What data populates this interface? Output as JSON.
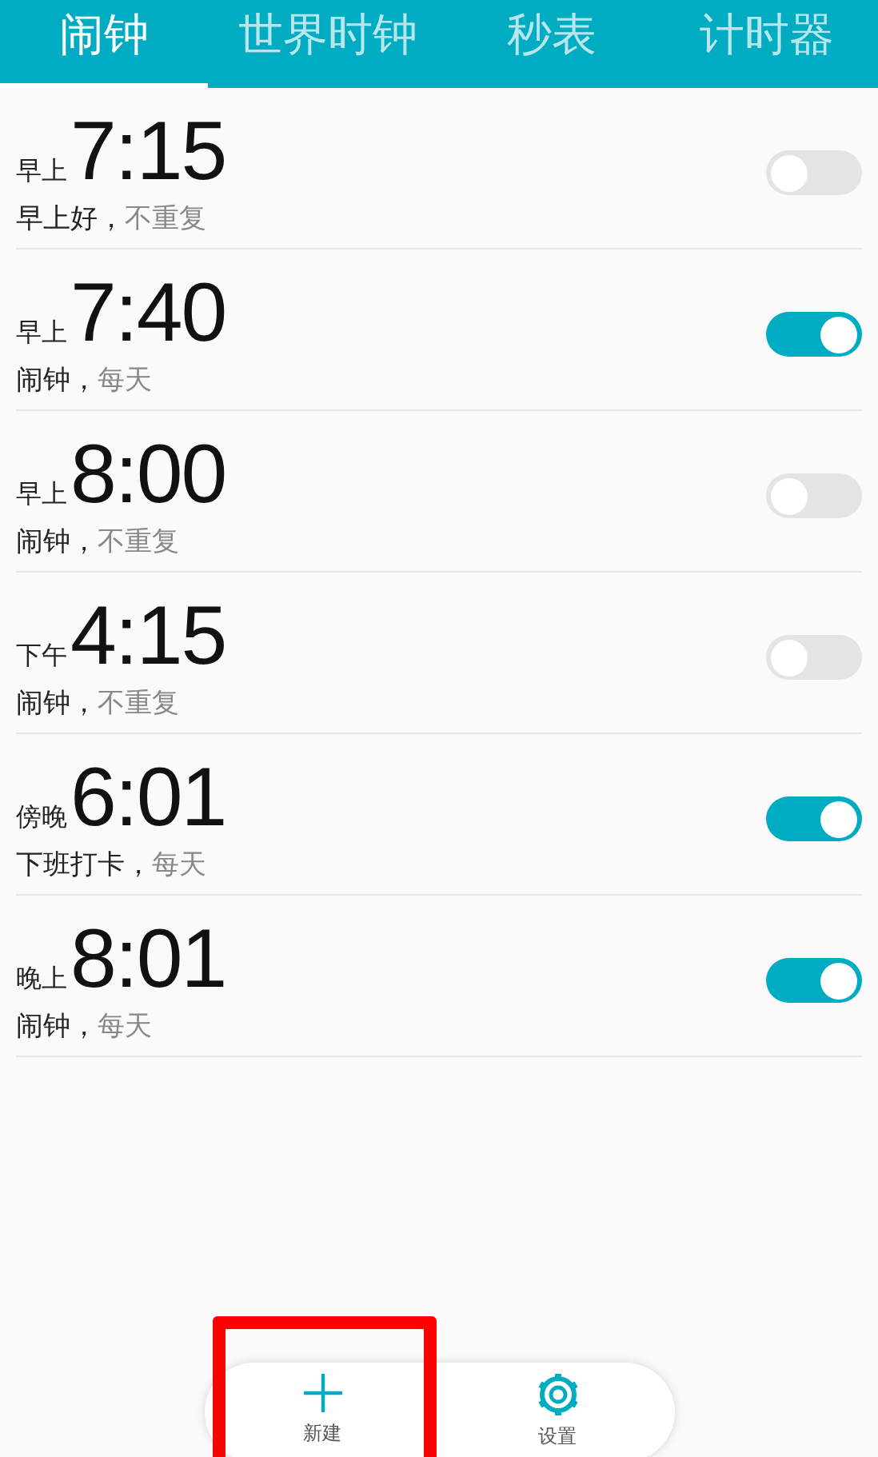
{
  "tabs": [
    {
      "label": "闹钟",
      "selected": true
    },
    {
      "label": "世界时钟",
      "selected": false
    },
    {
      "label": "秒表",
      "selected": false
    },
    {
      "label": "计时器",
      "selected": false
    }
  ],
  "alarms": [
    {
      "period": "早上",
      "time": "7:15",
      "name": "早上好，",
      "repeat": "不重复",
      "on": false
    },
    {
      "period": "早上",
      "time": "7:40",
      "name": "闹钟，",
      "repeat": "每天",
      "on": true
    },
    {
      "period": "早上",
      "time": "8:00",
      "name": "闹钟，",
      "repeat": "不重复",
      "on": false
    },
    {
      "period": "下午",
      "time": "4:15",
      "name": "闹钟，",
      "repeat": "不重复",
      "on": false
    },
    {
      "period": "傍晚",
      "time": "6:01",
      "name": "下班打卡，",
      "repeat": "每天",
      "on": true
    },
    {
      "period": "晚上",
      "time": "8:01",
      "name": "闹钟，",
      "repeat": "每天",
      "on": true
    }
  ],
  "actions": [
    {
      "kind": "add",
      "label": "新建"
    },
    {
      "kind": "settings",
      "label": "设置"
    }
  ]
}
